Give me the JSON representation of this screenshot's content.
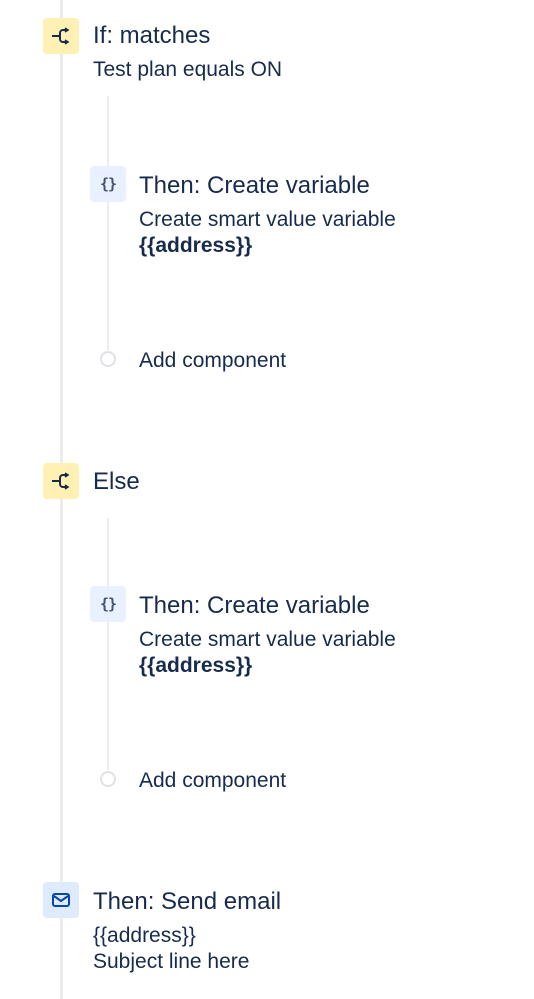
{
  "steps": {
    "if_condition": {
      "title": "If: matches",
      "subtitle": "Test plan equals ON",
      "icon": "branch-icon"
    },
    "then_var_1": {
      "title": "Then: Create variable",
      "subtitle": "Create smart value variable",
      "variable": "{{address}}",
      "icon": "braces-icon"
    },
    "add_1": {
      "label": "Add component"
    },
    "else_branch": {
      "title": "Else",
      "icon": "branch-icon"
    },
    "then_var_2": {
      "title": "Then: Create variable",
      "subtitle": "Create smart value variable",
      "variable": "{{address}}",
      "icon": "braces-icon"
    },
    "add_2": {
      "label": "Add component"
    },
    "send_email": {
      "title": "Then: Send email",
      "to": "{{address}}",
      "subject": "Subject line here",
      "icon": "mail-icon"
    }
  },
  "colors": {
    "condition_bg": "#fff0b3",
    "action_bg": "#deebff",
    "variable_bg": "#e9f0ff",
    "text": "#172b4d",
    "rail": "#ebecf0"
  }
}
